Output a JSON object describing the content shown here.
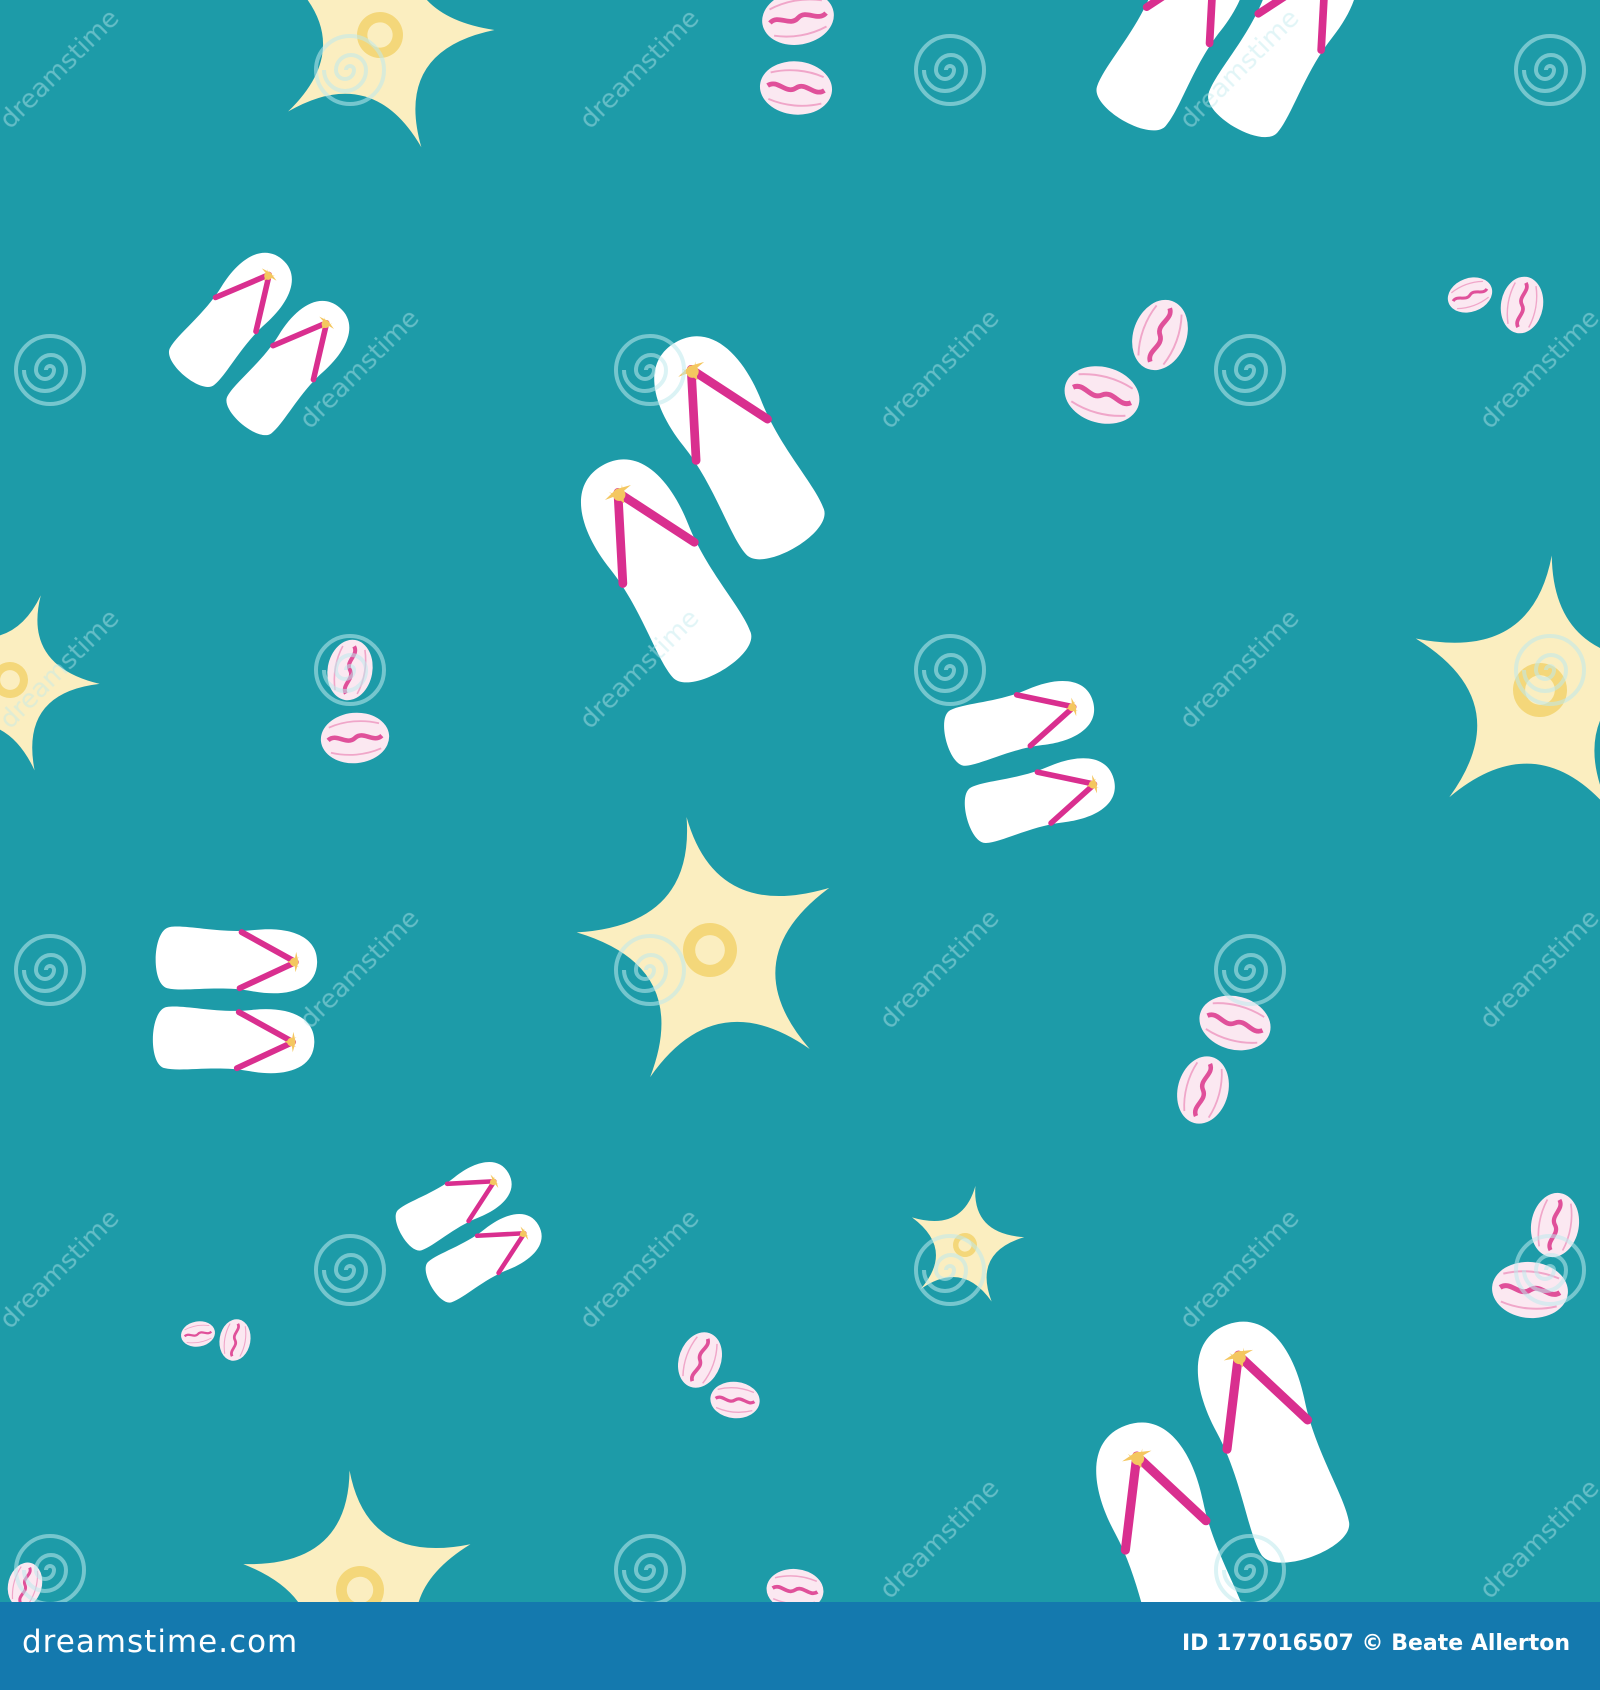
{
  "background_color": "#1d9ba8",
  "palette": {
    "sole": "#ffffff",
    "strap": "#d92f8f",
    "starfish": "#fbeec0",
    "starfish_center": "#f4d77a",
    "shell": "#fbe8f1",
    "shell_stripe": "#e0509a",
    "footer_bg": "#1479ae"
  },
  "watermark": {
    "text": "dreamstime",
    "icon": "spiral-icon"
  },
  "footer": {
    "site": "dreamstime.com",
    "image_id": "ID 177016507",
    "author": "© Beate Allerton"
  }
}
